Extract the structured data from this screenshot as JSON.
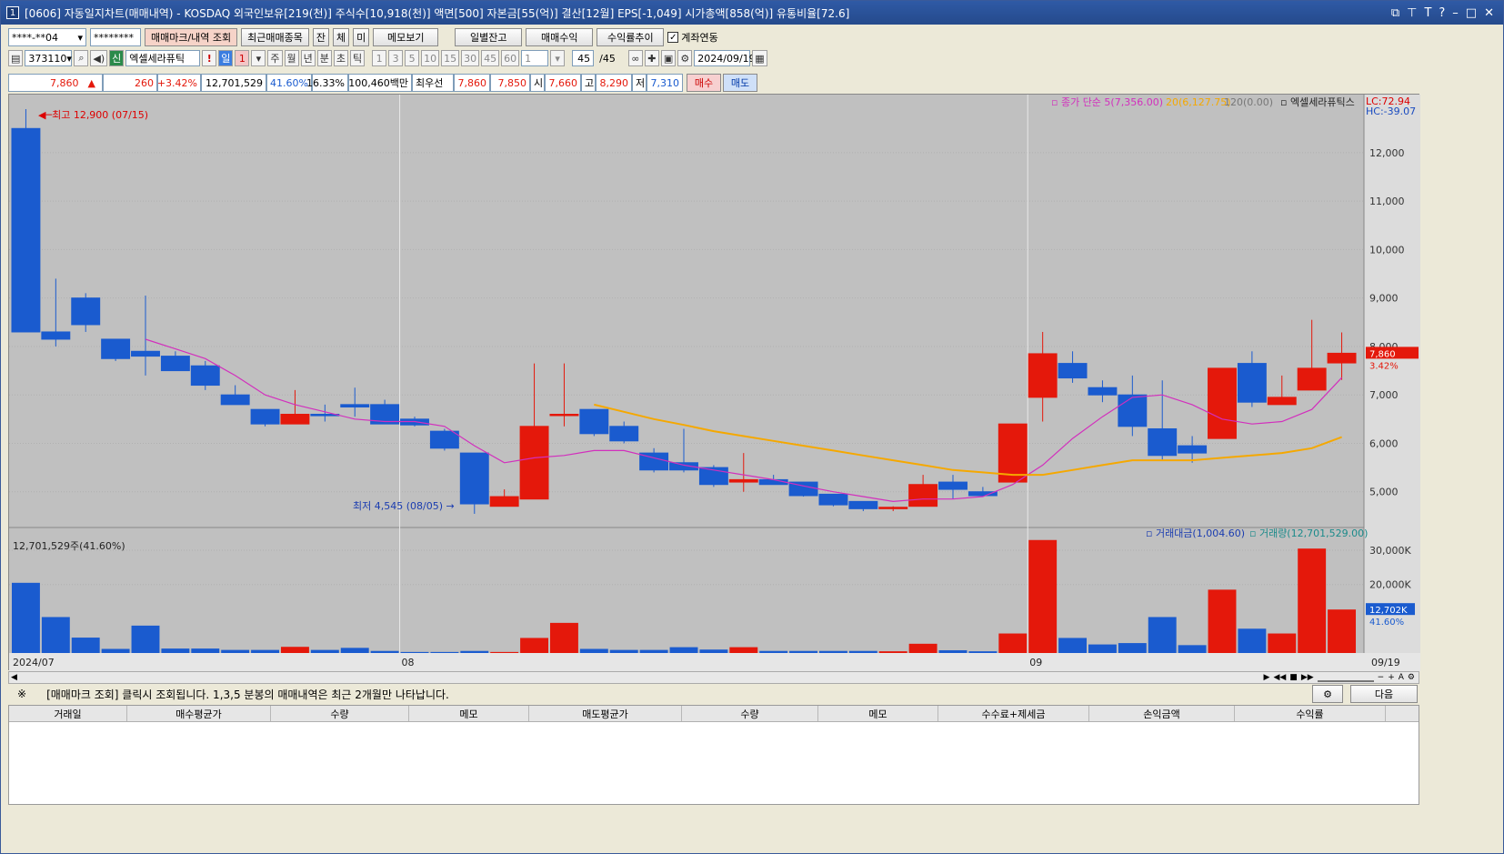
{
  "window": {
    "num": "1",
    "title": "[0606] 자동일지차트(매매내역) - KOSDAQ 외국인보유[219(천)] 주식수[10,918(천)] 액면[500] 자본금[55(억)] 결산[12월] EPS[-1,049] 시가총액[858(억)] 유통비율[72.6]"
  },
  "toolbar1": {
    "account": "****-**04",
    "password": "********",
    "btn_mark": "매매마크/내역 조회",
    "btn_recent": "최근매매종목",
    "btn_jan": "잔",
    "btn_che": "체",
    "btn_mi": "미",
    "btn_memo": "메모보기",
    "btn_daily": "일별잔고",
    "btn_profit": "매매수익",
    "btn_trend": "수익률추이",
    "chk_link": "계좌연동"
  },
  "toolbar2": {
    "code": "373110",
    "name": "엑셀세라퓨틱",
    "sin": "신",
    "excl": "!",
    "periods": [
      "일",
      "1",
      "주",
      "월",
      "년",
      "분",
      "초",
      "틱"
    ],
    "mins": [
      "1",
      "3",
      "5",
      "10",
      "15",
      "30",
      "45",
      "60"
    ],
    "mult": "1",
    "count": "45",
    "count_total": "/45",
    "date": "2024/09/19"
  },
  "quote": {
    "price": "7,860",
    "arrow": "▲",
    "change": "260",
    "rate": "+3.42%",
    "volume": "12,701,529",
    "vol_ratio": "41.60%",
    "turnover": "16.33%",
    "amount": "100,460백만",
    "best_label": "최우선",
    "best_ask": "7,860",
    "best_bid": "7,850",
    "open_label": "시",
    "open": "7,660",
    "high_label": "고",
    "high": "8,290",
    "low_label": "저",
    "low": "7,310",
    "buy": "매수",
    "sell": "매도"
  },
  "chart_data": {
    "type": "candlestick",
    "symbol_label": "엑셀세라퓨틱스",
    "ma_legend": {
      "ma5": "종가 단순 5(7,356.00)",
      "ma20": "20(6,127.75)",
      "ma120": "120(0.00)"
    },
    "lc": "LC:72.94",
    "hc": "HC:-39.07",
    "max_label": "최고 12,900 (07/15)",
    "min_label": "최저 4,545 (08/05)",
    "last_price_tag": "7,860",
    "last_rate_tag": "3.42%",
    "price_axis": [
      12000,
      11000,
      10000,
      9000,
      8000,
      7000,
      6000,
      5000
    ],
    "price_axis_labels": [
      "12,000",
      "11,000",
      "10,000",
      "9,000",
      "8,000",
      "7,000",
      "6,000",
      "5,000"
    ],
    "ylim": [
      4300,
      13200
    ],
    "candles": [
      {
        "o": 12500,
        "h": 12900,
        "l": 8300,
        "c": 8300
      },
      {
        "o": 8300,
        "h": 9400,
        "l": 8000,
        "c": 8150
      },
      {
        "o": 9000,
        "h": 9100,
        "l": 8300,
        "c": 8450
      },
      {
        "o": 8150,
        "h": 8150,
        "l": 7700,
        "c": 7750
      },
      {
        "o": 7900,
        "h": 9050,
        "l": 7400,
        "c": 7800
      },
      {
        "o": 7800,
        "h": 7900,
        "l": 7500,
        "c": 7500
      },
      {
        "o": 7600,
        "h": 7700,
        "l": 7100,
        "c": 7200
      },
      {
        "o": 7000,
        "h": 7200,
        "l": 6800,
        "c": 6800
      },
      {
        "o": 6700,
        "h": 6700,
        "l": 6350,
        "c": 6400
      },
      {
        "o": 6400,
        "h": 7100,
        "l": 6400,
        "c": 6600
      },
      {
        "o": 6600,
        "h": 6800,
        "l": 6450,
        "c": 6570
      },
      {
        "o": 6800,
        "h": 7150,
        "l": 6550,
        "c": 6750
      },
      {
        "o": 6800,
        "h": 6900,
        "l": 6400,
        "c": 6400
      },
      {
        "o": 6500,
        "h": 6550,
        "l": 6350,
        "c": 6380
      },
      {
        "o": 6250,
        "h": 6300,
        "l": 5850,
        "c": 5900
      },
      {
        "o": 5800,
        "h": 5800,
        "l": 4545,
        "c": 4750
      },
      {
        "o": 4700,
        "h": 5050,
        "l": 4700,
        "c": 4900
      },
      {
        "o": 4850,
        "h": 7650,
        "l": 4850,
        "c": 6350
      },
      {
        "o": 6600,
        "h": 7650,
        "l": 6350,
        "c": 6600
      },
      {
        "o": 6700,
        "h": 6700,
        "l": 6150,
        "c": 6200
      },
      {
        "o": 6350,
        "h": 6450,
        "l": 6000,
        "c": 6050
      },
      {
        "o": 5800,
        "h": 5900,
        "l": 5400,
        "c": 5450
      },
      {
        "o": 5600,
        "h": 6300,
        "l": 5400,
        "c": 5450
      },
      {
        "o": 5500,
        "h": 5550,
        "l": 5100,
        "c": 5150
      },
      {
        "o": 5200,
        "h": 5800,
        "l": 5000,
        "c": 5250
      },
      {
        "o": 5250,
        "h": 5350,
        "l": 5150,
        "c": 5150
      },
      {
        "o": 5200,
        "h": 5200,
        "l": 4900,
        "c": 4920
      },
      {
        "o": 4950,
        "h": 4950,
        "l": 4700,
        "c": 4730
      },
      {
        "o": 4800,
        "h": 4800,
        "l": 4600,
        "c": 4650
      },
      {
        "o": 4650,
        "h": 4700,
        "l": 4600,
        "c": 4680
      },
      {
        "o": 4700,
        "h": 5350,
        "l": 4700,
        "c": 5150
      },
      {
        "o": 5200,
        "h": 5350,
        "l": 4850,
        "c": 5050
      },
      {
        "o": 5000,
        "h": 5100,
        "l": 4900,
        "c": 4920
      },
      {
        "o": 5200,
        "h": 6400,
        "l": 5200,
        "c": 6400
      },
      {
        "o": 6950,
        "h": 8300,
        "l": 6450,
        "c": 7850
      },
      {
        "o": 7650,
        "h": 7900,
        "l": 7250,
        "c": 7350
      },
      {
        "o": 7150,
        "h": 7300,
        "l": 6850,
        "c": 7000
      },
      {
        "o": 7000,
        "h": 7400,
        "l": 6150,
        "c": 6350
      },
      {
        "o": 6300,
        "h": 7300,
        "l": 5650,
        "c": 5750
      },
      {
        "o": 5950,
        "h": 6150,
        "l": 5600,
        "c": 5800
      },
      {
        "o": 6100,
        "h": 7550,
        "l": 6100,
        "c": 7550
      },
      {
        "o": 7650,
        "h": 7900,
        "l": 6750,
        "c": 6850
      },
      {
        "o": 6800,
        "h": 7400,
        "l": 6800,
        "c": 6950
      },
      {
        "o": 7100,
        "h": 8550,
        "l": 7100,
        "c": 7550
      },
      {
        "o": 7660,
        "h": 8290,
        "l": 7310,
        "c": 7860
      }
    ],
    "ma5": [
      null,
      null,
      null,
      null,
      8150,
      7950,
      7750,
      7400,
      7000,
      6800,
      6650,
      6500,
      6450,
      6450,
      6350,
      5950,
      5600,
      5700,
      5750,
      5850,
      5850,
      5700,
      5550,
      5450,
      5350,
      5250,
      5120,
      5000,
      4900,
      4800,
      4850,
      4850,
      4900,
      5150,
      5550,
      6100,
      6550,
      6950,
      7000,
      6800,
      6500,
      6400,
      6450,
      6700,
      7356
    ],
    "ma20": [
      null,
      null,
      null,
      null,
      null,
      null,
      null,
      null,
      null,
      null,
      null,
      null,
      null,
      null,
      null,
      null,
      null,
      null,
      null,
      6800,
      6650,
      6500,
      6380,
      6250,
      6150,
      6050,
      5950,
      5850,
      5750,
      5650,
      5550,
      5450,
      5400,
      5350,
      5350,
      5450,
      5550,
      5650,
      5650,
      5650,
      5700,
      5750,
      5800,
      5900,
      6128
    ],
    "volume": [
      20500,
      10500,
      4500,
      1200,
      8000,
      1300,
      1300,
      900,
      900,
      1800,
      900,
      1500,
      600,
      300,
      300,
      600,
      300,
      4400,
      8800,
      1200,
      900,
      900,
      1700,
      1000,
      1700,
      600,
      600,
      600,
      600,
      500,
      2700,
      800,
      500,
      5700,
      33000,
      4400,
      2500,
      2900,
      10500,
      2300,
      18500,
      7100,
      5700,
      30500,
      12702
    ],
    "vol_axis_labels": [
      "30,000K",
      "20,000K"
    ],
    "vol_axis_values": [
      30000,
      20000
    ],
    "vol_ylim": [
      0,
      34000
    ],
    "vol_tag": "12,702K",
    "vol_rate_tag": "41.60%",
    "vol_text": "12,701,529주(41.60%)",
    "vol_legend": {
      "amount": "거래대금(1,004.60)",
      "volume": "거래량(12,701,529.00)"
    },
    "x_labels": [
      {
        "i": 0,
        "text": "2024/07"
      },
      {
        "i": 13,
        "text": "08"
      },
      {
        "i": 34,
        "text": "09"
      }
    ],
    "x_end_label": "09/19",
    "colors": {
      "up": "#e4180b",
      "down": "#1a5bcf",
      "ma5": "#d22fbd",
      "ma20": "#f5a800",
      "bg": "#c0c0c0"
    }
  },
  "note": {
    "mark": "※",
    "text": "[매매마크 조회] 클릭시 조회됩니다. 1,3,5 분봉의 매매내역은 최근 2개월만 나타납니다.",
    "next": "다음"
  },
  "table": {
    "columns": [
      "거래일",
      "매수평균가",
      "수량",
      "메모",
      "매도평균가",
      "수량",
      "메모",
      "수수료+제세금",
      "손익금액",
      "수익률"
    ]
  }
}
